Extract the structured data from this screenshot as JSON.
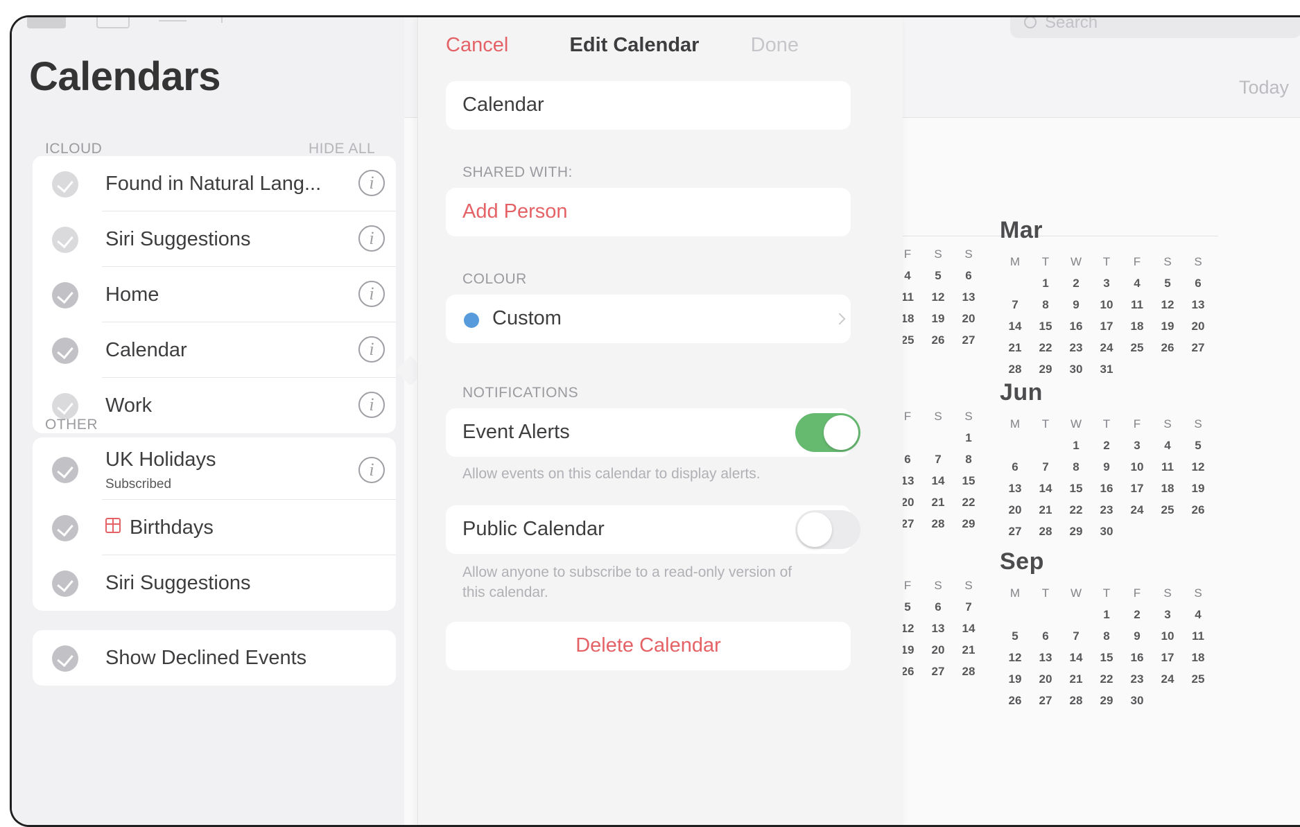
{
  "sidebar": {
    "title": "Calendars",
    "icloud_label": "ICLOUD",
    "hide_all": "HIDE ALL",
    "other_label": "OTHER",
    "icloud_items": [
      {
        "label": "Found in Natural Lang..."
      },
      {
        "label": "Siri Suggestions"
      },
      {
        "label": "Home"
      },
      {
        "label": "Calendar"
      },
      {
        "label": "Work"
      }
    ],
    "other_items": [
      {
        "label": "UK Holidays",
        "sublabel": "Subscribed"
      },
      {
        "label": "Birthdays"
      },
      {
        "label": "Siri Suggestions"
      }
    ],
    "show_declined": "Show Declined Events"
  },
  "popover": {
    "cancel": "Cancel",
    "title": "Edit Calendar",
    "done": "Done",
    "name_value": "Calendar",
    "shared_with_label": "SHARED WITH:",
    "add_person": "Add Person",
    "colour_label": "COLOUR",
    "colour_value": "Custom",
    "colour_hex": "#3a8ad6",
    "notifications_label": "NOTIFICATIONS",
    "event_alerts": "Event Alerts",
    "event_alerts_on": true,
    "event_alerts_note": "Allow events on this calendar to display alerts.",
    "public_calendar": "Public Calendar",
    "public_calendar_on": false,
    "public_note_line1": "Allow anyone to subscribe to a read-only version of",
    "public_note_line2": "this calendar.",
    "delete": "Delete Calendar"
  },
  "header": {
    "search_placeholder": "Search",
    "today": "Today"
  },
  "months": {
    "mar": {
      "name": "Mar",
      "weekdays": [
        "M",
        "T",
        "W",
        "T",
        "F",
        "S",
        "S"
      ],
      "offset": 1,
      "days": 31
    },
    "jun": {
      "name": "Jun",
      "weekdays": [
        "M",
        "T",
        "W",
        "T",
        "F",
        "S",
        "S"
      ],
      "offset": 2,
      "days": 30
    },
    "sep": {
      "name": "Sep",
      "weekdays": [
        "M",
        "T",
        "W",
        "T",
        "F",
        "S",
        "S"
      ],
      "offset": 3,
      "days": 30
    }
  },
  "partial_months": {
    "weekdays": [
      "F",
      "S",
      "S"
    ],
    "feb_rows": [
      [
        "4",
        "5",
        "6"
      ],
      [
        "11",
        "12",
        "13"
      ],
      [
        "18",
        "19",
        "20"
      ],
      [
        "25",
        "26",
        "27"
      ]
    ],
    "may_rows": [
      [
        "",
        "",
        "1"
      ],
      [
        "6",
        "7",
        "8"
      ],
      [
        "13",
        "14",
        "15"
      ],
      [
        "20",
        "21",
        "22"
      ],
      [
        "27",
        "28",
        "29"
      ]
    ],
    "aug_rows": [
      [
        "5",
        "6",
        "7"
      ],
      [
        "12",
        "13",
        "14"
      ],
      [
        "19",
        "20",
        "21"
      ],
      [
        "26",
        "27",
        "28"
      ]
    ]
  },
  "colors": {
    "accent_red": "#e0474c",
    "toggle_green": "#4cae58"
  }
}
